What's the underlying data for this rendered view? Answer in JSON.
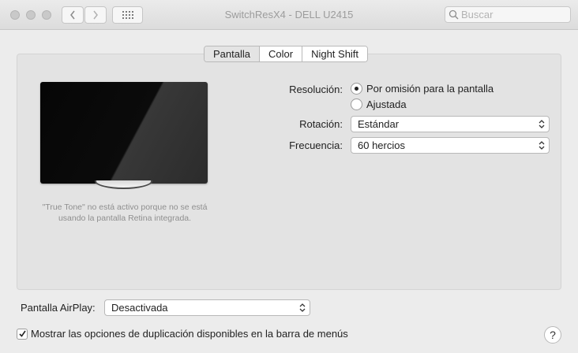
{
  "window": {
    "title": "SwitchResX4 - DELL U2415",
    "search_placeholder": "Buscar"
  },
  "toolbar": {
    "back_icon": "chevron-left-icon",
    "forward_icon": "chevron-right-icon",
    "grid_icon": "grid-icon"
  },
  "tabs": [
    {
      "label": "Pantalla",
      "active": true
    },
    {
      "label": "Color",
      "active": false
    },
    {
      "label": "Night Shift",
      "active": false
    }
  ],
  "display_note": "\"True Tone\" no está activo porque no se está usando la pantalla Retina integrada.",
  "resolution": {
    "label": "Resolución:",
    "options": [
      {
        "label": "Por omisión para la pantalla",
        "selected": true
      },
      {
        "label": "Ajustada",
        "selected": false
      }
    ]
  },
  "rotation": {
    "label": "Rotación:",
    "value": "Estándar"
  },
  "frequency": {
    "label": "Frecuencia:",
    "value": "60 hercios"
  },
  "airplay": {
    "label": "Pantalla AirPlay:",
    "value": "Desactivada"
  },
  "mirror_option": {
    "label": "Mostrar las opciones de duplicación disponibles en la barra de menús",
    "checked": true
  },
  "help": {
    "label": "?"
  }
}
